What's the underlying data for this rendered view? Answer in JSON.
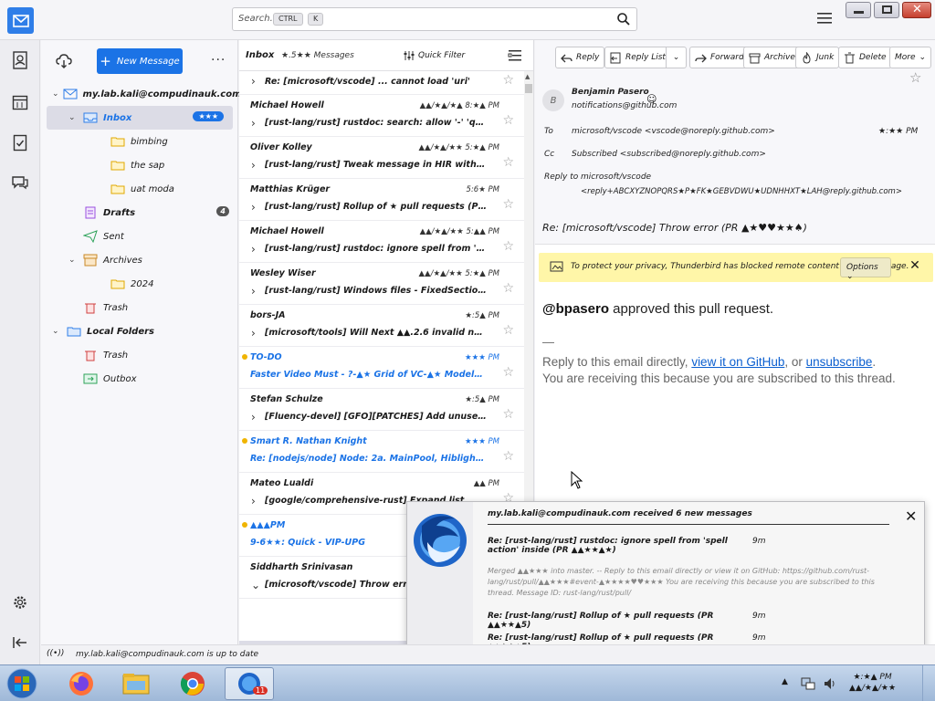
{
  "search": {
    "placeholder": "Search...",
    "kbd_ctrl": "CTRL",
    "kbd_k": "K"
  },
  "folder_pane": {
    "new_message": "New Message",
    "more": "···",
    "folders": [
      {
        "label": "my.lab.kali@compudinauk.com",
        "level": 0,
        "icon": "account-icon",
        "twisty": "v",
        "badge": ""
      },
      {
        "label": "Inbox",
        "level": 1,
        "icon": "inbox-icon",
        "twisty": "v",
        "badge": "★★★",
        "selected": true
      },
      {
        "label": "bimbing",
        "level": 2,
        "icon": "folder-icon",
        "twisty": "",
        "badge": ""
      },
      {
        "label": "the sap",
        "level": 2,
        "icon": "folder-icon",
        "twisty": "",
        "badge": ""
      },
      {
        "label": "uat moda",
        "level": 2,
        "icon": "folder-icon",
        "twisty": "",
        "badge": ""
      },
      {
        "label": "Drafts",
        "level": 1,
        "icon": "drafts-icon",
        "twisty": "",
        "badge": "4",
        "badge_gray": true
      },
      {
        "label": "Sent",
        "level": 1,
        "icon": "sent-icon",
        "twisty": "",
        "badge": ""
      },
      {
        "label": "Archives",
        "level": 1,
        "icon": "archive-icon",
        "twisty": "v",
        "badge": ""
      },
      {
        "label": "2024",
        "level": 2,
        "icon": "folder-icon",
        "twisty": "",
        "badge": ""
      },
      {
        "label": "Trash",
        "level": 1,
        "icon": "trash-icon",
        "twisty": "",
        "badge": ""
      },
      {
        "label": "Local Folders",
        "level": 0,
        "icon": "local-folders-icon",
        "twisty": "v",
        "badge": ""
      },
      {
        "label": "Trash",
        "level": 1,
        "icon": "trash-icon",
        "twisty": "",
        "badge": ""
      },
      {
        "label": "Outbox",
        "level": 1,
        "icon": "outbox-icon",
        "twisty": "",
        "badge": ""
      }
    ]
  },
  "list": {
    "title": "Inbox",
    "count": "★.5★★ Messages",
    "quick_filter": "Quick Filter",
    "messages": [
      {
        "from": "",
        "subject": "Re: [microsoft/vscode] ... cannot load 'uri'",
        "date": "",
        "unread": false,
        "partial": true
      },
      {
        "from": "Michael Howell",
        "subject": "[rust-lang/rust] rustdoc: search: allow '-' 'quit' ... (PR ...",
        "date": "▲▲/★▲/★▲ 8:★▲ PM",
        "unread": false
      },
      {
        "from": "Oliver Kolley",
        "subject": "[rust-lang/rust] Tweak message in HIR with private fields (...",
        "date": "▲▲/★▲/★★ 5:★▲ PM",
        "unread": false
      },
      {
        "from": "Matthias Krüger",
        "subject": "[rust-lang/rust] Rollup of ★ pull requests (PR ▲▲★▲...",
        "date": "5:6★ PM",
        "unread": false
      },
      {
        "from": "Michael Howell",
        "subject": "[rust-lang/rust] rustdoc: ignore spell from 'spell action' inside...",
        "date": "▲▲/★▲/★★ 5:▲▲ PM",
        "unread": false
      },
      {
        "from": "Wesley Wiser",
        "subject": "[rust-lang/rust] Windows files - FixedSections and in this...",
        "date": "▲▲/★▲/★★ 5:★▲ PM",
        "unread": false
      },
      {
        "from": "bors-JA",
        "subject": "[microsoft/tools] Will Next ▲▲.2.6 invalid not working (...",
        "date": "★:5▲ PM",
        "unread": false
      },
      {
        "from": "TO-DO",
        "subject": "Faster Video Must - ?-▲★ Grid of VC-▲★ ModelForcing G...",
        "date": "★★★ PM",
        "unread": true,
        "dot": true
      },
      {
        "from": "Stefan Schulze",
        "subject": "[Fluency-devel] [GFO][PATCHES] Add unused...",
        "date": "★:5▲ PM",
        "unread": false
      },
      {
        "from": "Smart R. Nathan Knight",
        "subject": "Re: [nodejs/node] Node: 2a. MainPool, Hiblight in 'att ge' (...",
        "date": "★★★ PM",
        "unread": true,
        "dot": true
      },
      {
        "from": "Mateo Lualdi",
        "subject": "[google/comprehensive-rust] Expand list...",
        "date": "▲▲ PM",
        "unread": false
      },
      {
        "from": "▲▲▲PM",
        "subject": "9-6★★: Quick - VIP-UPG",
        "date": "",
        "unread": true,
        "dot": true
      },
      {
        "from": "Siddharth Srinivasan",
        "subject": "[microsoft/vscode] Throw error (PR ...",
        "date": "",
        "unread": false,
        "expanded": true
      }
    ],
    "thread_child": [
      "Benjamin Pasero",
      "Re: [microsoft/vscode] Throw error (PR"
    ]
  },
  "reader": {
    "buttons": [
      "Reply",
      "Reply List",
      "Forward",
      "Archive",
      "Junk",
      "Delete",
      "More"
    ],
    "from_name": "Benjamin Pasero",
    "from_addr": "notifications@github.com",
    "to_label": "To",
    "to_value": "microsoft/vscode <vscode@noreply.github.com>",
    "cc_label": "Cc",
    "cc_value": "Subscribed <subscribed@noreply.github.com>",
    "replyto_label": "Reply to",
    "replyto_value_1": "microsoft/vscode",
    "replyto_value_2": "<reply+ABCXYZNOPQRS★P★FK★GEBVDWU★UDNHHXT★LAH@reply.github.com>",
    "date": "★:★★ PM",
    "subject": "Re: [microsoft/vscode] Throw error (PR ▲★♥♥★★♠)",
    "remote_notice": "To protect your privacy, Thunderbird has blocked remote content in this message.",
    "remote_options": "Options",
    "body_handle": "@bpasero",
    "body_text": " approved this pull request.",
    "body_sep": "—",
    "foot_1a": "Reply to this email directly, ",
    "foot_link1": "view it on GitHub",
    "foot_1b": ", or ",
    "foot_link2": "unsubscribe",
    "foot_1c": ".",
    "foot_2": "You are receiving this because you are subscribed to this thread."
  },
  "notification": {
    "header": "my.lab.kali@compudinauk.com received 6 new messages",
    "rows": [
      {
        "subject": "Re: [rust-lang/rust] rustdoc: ignore spell from 'spell action' inside (PR ▲▲★★▲★)",
        "date": "9m"
      },
      {
        "subject": "Re: [rust-lang/rust] Rollup of ★ pull requests (PR ▲▲★★▲5)",
        "date": "9m"
      },
      {
        "subject": "Re: [rust-lang/rust] Rollup of ★ pull requests (PR ▲▲★★▲5)",
        "date": "9m"
      }
    ],
    "preview": "Merged ▲▲★★★ into master. -- Reply to this email directly or view it on GitHub: https://github.com/rust-lang/rust/pull/▲▲★★★#event-▲★★★★♥♥★★★ You are receiving this because you are subscribed to this thread. Message ID: rust-lang/rust/pull/"
  },
  "status": {
    "text": "my.lab.kali@compudinauk.com is up to date"
  },
  "taskbar": {
    "time": "★:★▲ PM",
    "date": "▲▲/★▲/★★",
    "badge": "11"
  },
  "colors": {
    "accent": "#1b73e6",
    "notice": "#fff6a8",
    "unread": "#1b73e6"
  }
}
